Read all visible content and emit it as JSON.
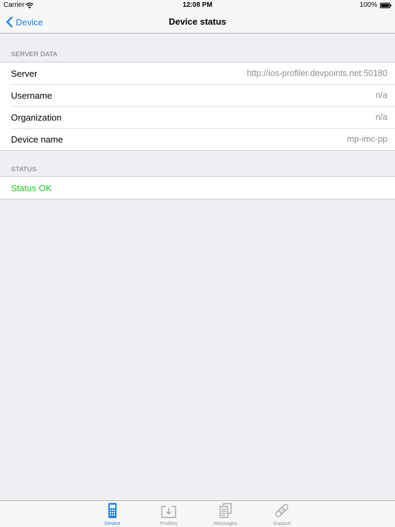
{
  "status_bar": {
    "carrier": "Carrier",
    "time": "12:08 PM",
    "battery": "100%"
  },
  "nav": {
    "back_label": "Device",
    "title": "Device status"
  },
  "server_section": {
    "header": "SERVER DATA",
    "rows": [
      {
        "label": "Server",
        "value": "http://ios-profiler.devpoints.net:50180"
      },
      {
        "label": "Username",
        "value": "n/a"
      },
      {
        "label": "Organization",
        "value": "n/a"
      },
      {
        "label": "Device name",
        "value": "mp-imc-pp"
      }
    ]
  },
  "status_section": {
    "header": "STATUS",
    "status_text": "Status OK",
    "status_color": "#1dc61d"
  },
  "tabs": [
    {
      "label": "Device",
      "icon": "device-icon",
      "active": true
    },
    {
      "label": "Profiles",
      "icon": "profiles-download-icon",
      "active": false
    },
    {
      "label": "Messages",
      "icon": "messages-icon",
      "active": false
    },
    {
      "label": "Support",
      "icon": "support-bandage-icon",
      "active": false
    }
  ],
  "accent_color": "#1f7ee0"
}
